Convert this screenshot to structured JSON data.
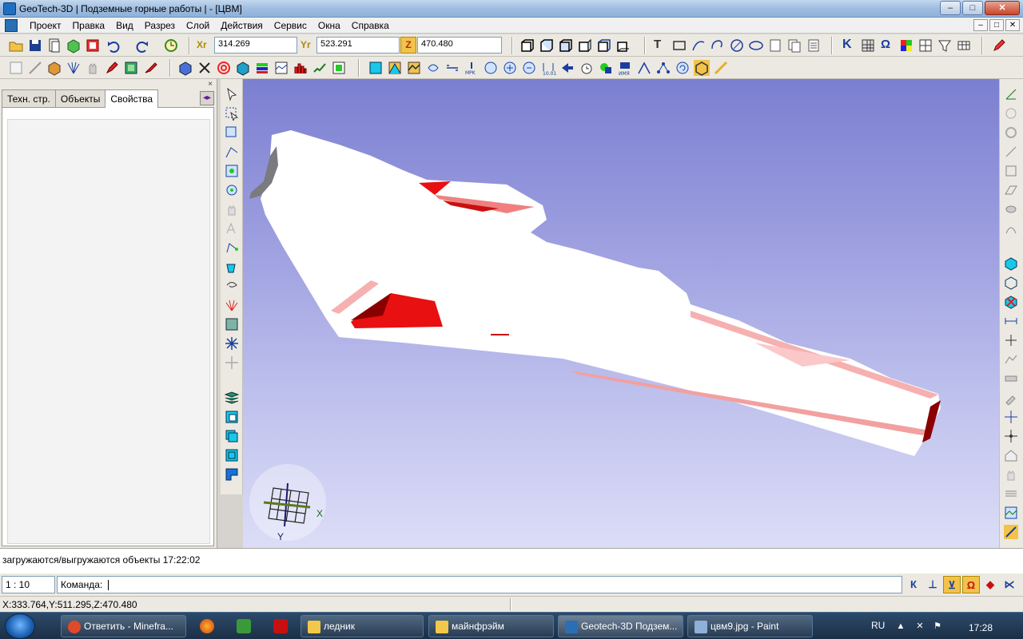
{
  "window": {
    "title": "GeoTech-3D | Подземные горные работы | - [ЦВМ]",
    "buttons": {
      "minimize": "–",
      "maximize": "□",
      "close": "✕"
    }
  },
  "menu": {
    "items": [
      "Проект",
      "Правка",
      "Вид",
      "Разрез",
      "Слой",
      "Действия",
      "Сервис",
      "Окна",
      "Справка"
    ]
  },
  "toolbar": {
    "x_label": "Xr",
    "x_value": "314.269",
    "y_label": "Yr",
    "y_value": "523.291",
    "z_label": "Z",
    "z_value": "470.480",
    "text_tool": "T",
    "k_tool": "K",
    "omega_tool": "Ω"
  },
  "left_panel": {
    "tabs": [
      "Техн. стр.",
      "Объекты",
      "Свойства"
    ],
    "active_tab": "Свойства",
    "close": "×",
    "arrow": "◂▸"
  },
  "viewport": {
    "axis_x_label": "X",
    "axis_y_label": "Y",
    "background_top": "#7b7fd0",
    "background_bottom": "#dcddf7",
    "model_color": "#ffffff",
    "highlight_color": "#e81010",
    "dark_highlight_color": "#8a0000"
  },
  "log": {
    "message": "загружаются/выгружаются объекты 17:22:02"
  },
  "command": {
    "scale": "1 : 10",
    "prompt": "Команда:",
    "snaps": [
      "К",
      "⊥",
      "⊻",
      "Ω",
      "◆",
      "⋉"
    ]
  },
  "status": {
    "cursor": "X:333.764,Y:511.295,Z:470.480"
  },
  "taskbar": {
    "tasks": [
      {
        "label": "Ответить - Minefra...",
        "icon_color": "#e04a2a",
        "active": false
      },
      {
        "label": "ледник",
        "icon_color": "#f1c84a",
        "active": false
      },
      {
        "label": "майнфрэйм",
        "icon_color": "#f1c84a",
        "active": false
      },
      {
        "label": "Geotech-3D Подзем...",
        "icon_color": "#2a6fb5",
        "active": true
      },
      {
        "label": "цвм9.jpg - Paint",
        "icon_color": "#8fb0d9",
        "active": false
      }
    ],
    "language": "RU",
    "clock": "17:28"
  }
}
